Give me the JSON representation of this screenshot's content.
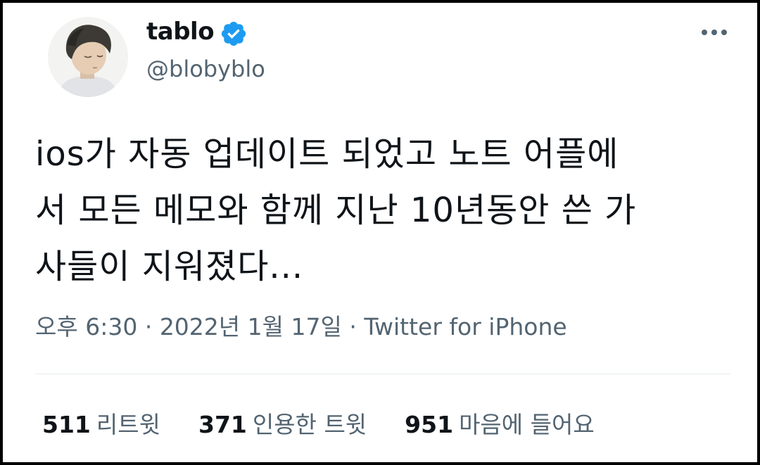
{
  "author": {
    "display_name": "tablo",
    "handle": "@blobyblo",
    "verified_color": "#1d9bf0"
  },
  "tweet": {
    "lines": [
      "ios가 자동 업데이트 되었고 노트 어플에",
      "서 모든 메모와 함께 지난 10년동안 쓴 가",
      "사들이 지워졌다..."
    ]
  },
  "meta": {
    "time": "오후 6:30",
    "separator": " · ",
    "date": "2022년 1월 17일",
    "source": "Twitter for iPhone"
  },
  "stats": [
    {
      "count": "511",
      "label": "리트윗"
    },
    {
      "count": "371",
      "label": "인용한 트윗"
    },
    {
      "count": "951",
      "label": "마음에 들어요"
    }
  ],
  "icons": {
    "more": "more-horizontal-icon",
    "verified": "verified-badge-icon"
  }
}
